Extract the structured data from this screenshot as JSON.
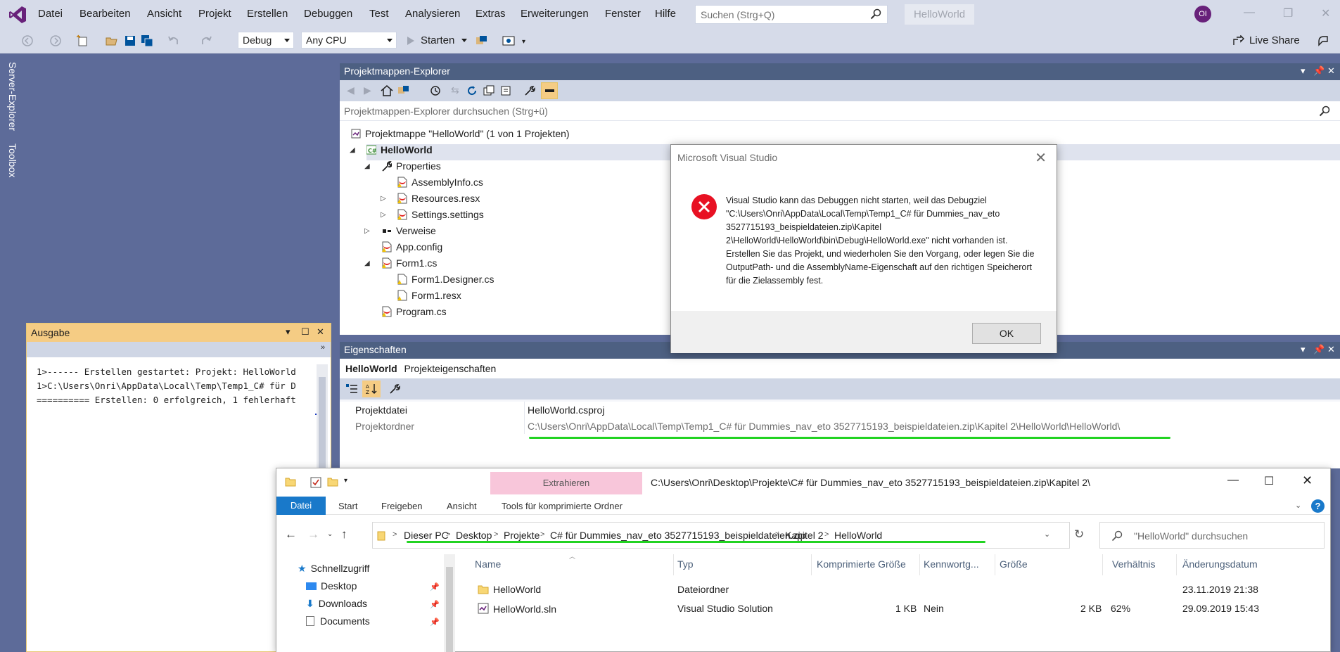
{
  "menu": [
    "Datei",
    "Bearbeiten",
    "Ansicht",
    "Projekt",
    "Erstellen",
    "Debuggen",
    "Test",
    "Analysieren",
    "Extras",
    "Erweiterungen",
    "Fenster",
    "Hilfe"
  ],
  "search": {
    "placeholder": "Suchen (Strg+Q)"
  },
  "app_title": "HelloWorld",
  "avatar": "OI",
  "toolbar": {
    "config": "Debug",
    "platform": "Any CPU",
    "start": "Starten",
    "live_share": "Live Share"
  },
  "side_tabs": [
    "Server-Explorer",
    "Toolbox"
  ],
  "solution_explorer": {
    "title": "Projektmappen-Explorer",
    "search_placeholder": "Projektmappen-Explorer durchsuchen (Strg+ü)",
    "tree": [
      {
        "label": "Projektmappe \"HelloWorld\" (1 von 1 Projekten)"
      },
      {
        "label": "HelloWorld"
      },
      {
        "label": "Properties"
      },
      {
        "label": "AssemblyInfo.cs"
      },
      {
        "label": "Resources.resx"
      },
      {
        "label": "Settings.settings"
      },
      {
        "label": "Verweise"
      },
      {
        "label": "App.config"
      },
      {
        "label": "Form1.cs"
      },
      {
        "label": "Form1.Designer.cs"
      },
      {
        "label": "Form1.resx"
      },
      {
        "label": "Program.cs"
      }
    ]
  },
  "properties": {
    "title": "Eigenschaften",
    "object": "HelloWorld",
    "object_type": "Projekteigenschaften",
    "rows": [
      {
        "key": "Projektdatei",
        "value": "HelloWorld.csproj"
      },
      {
        "key": "Projektordner",
        "value": "C:\\Users\\Onri\\AppData\\Local\\Temp\\Temp1_C# für Dummies_nav_eto 3527715193_beispieldateien.zip\\Kapitel 2\\HelloWorld\\HelloWorld\\"
      }
    ]
  },
  "output": {
    "title": "Ausgabe",
    "lines": [
      "1>------ Erstellen gestartet: Projekt: HelloWorld",
      "1>C:\\Users\\Onri\\AppData\\Local\\Temp\\Temp1_C# für D",
      "========== Erstellen: 0 erfolgreich, 1 fehlerhaft"
    ]
  },
  "dialog": {
    "title": "Microsoft Visual Studio",
    "message": "Visual Studio kann das Debuggen nicht starten, weil das Debugziel \"C:\\Users\\Onri\\AppData\\Local\\Temp\\Temp1_C# für Dummies_nav_eto 3527715193_beispieldateien.zip\\Kapitel 2\\HelloWorld\\HelloWorld\\bin\\Debug\\HelloWorld.exe\" nicht vorhanden ist. Erstellen Sie das Projekt, und wiederholen Sie den Vorgang, oder legen Sie die OutputPath- und die AssemblyName-Eigenschaft auf den richtigen Speicherort für die Zielassembly fest.",
    "ok": "OK"
  },
  "explorer": {
    "extract_tab": "Extrahieren",
    "title": "C:\\Users\\Onri\\Desktop\\Projekte\\C# für Dummies_nav_eto 3527715193_beispieldateien.zip\\Kapitel 2\\",
    "ribbon_tabs": [
      "Datei",
      "Start",
      "Freigeben",
      "Ansicht",
      "Tools für komprimierte Ordner"
    ],
    "breadcrumbs": [
      "Dieser PC",
      "Desktop",
      "Projekte",
      "C# für Dummies_nav_eto 3527715193_beispieldateien.zip",
      "Kapitel 2",
      "HelloWorld"
    ],
    "search_placeholder": "\"HelloWorld\" durchsuchen",
    "nav": [
      "Schnellzugriff",
      "Desktop",
      "Downloads",
      "Documents"
    ],
    "columns": [
      "Name",
      "Typ",
      "Komprimierte Größe",
      "Kennwortg...",
      "Größe",
      "Verhältnis",
      "Änderungsdatum"
    ],
    "files": [
      {
        "name": "HelloWorld",
        "type": "Dateiordner",
        "csize": "",
        "pw": "",
        "size": "",
        "ratio": "",
        "date": "23.11.2019 21:38"
      },
      {
        "name": "HelloWorld.sln",
        "type": "Visual Studio Solution",
        "csize": "1 KB",
        "pw": "Nein",
        "size": "2 KB",
        "ratio": "62%",
        "date": "29.09.2019 15:43"
      }
    ]
  },
  "colors": {
    "accent": "#5d6b99",
    "menubar": "#d6dbe9",
    "panel_title": "#4d6082",
    "output_title": "#f5cc84",
    "error": "#e81123",
    "highlight": "#22d322"
  }
}
